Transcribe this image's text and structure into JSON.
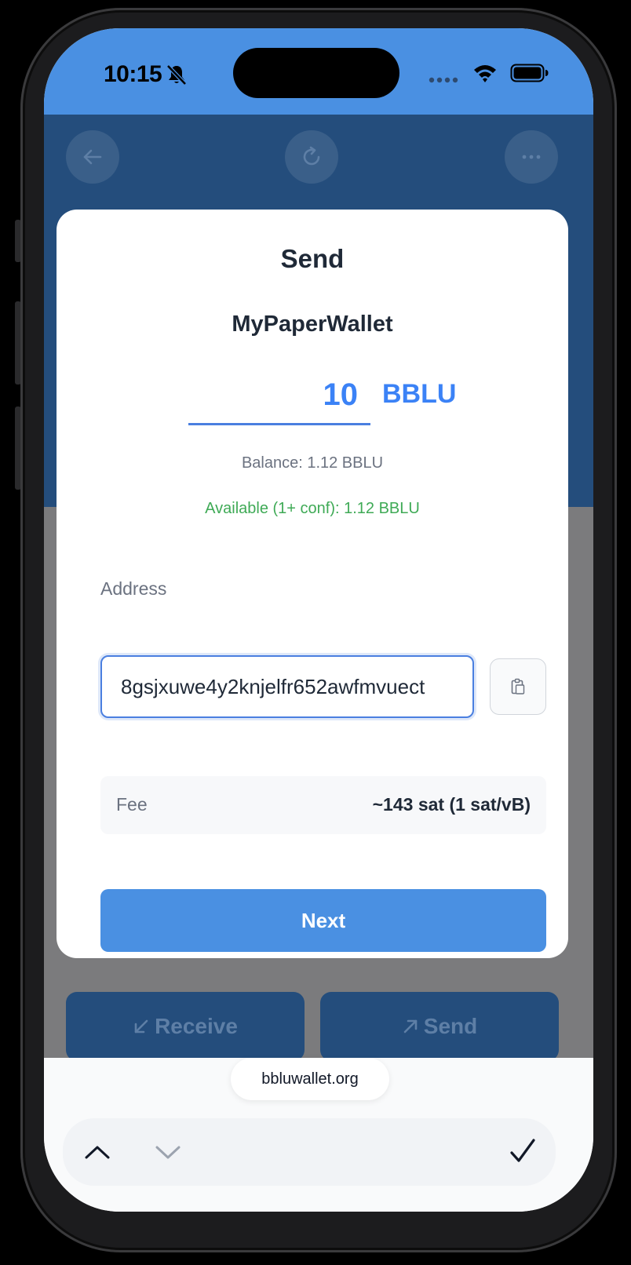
{
  "status_bar": {
    "time": "10:15"
  },
  "app": {
    "receive_label": "Receive",
    "send_label": "Send"
  },
  "modal": {
    "title": "Send",
    "wallet_name": "MyPaperWallet",
    "amount": "10",
    "unit": "BBLU",
    "balance": "Balance: 1.12 BBLU",
    "available": "Available (1+ conf): 1.12 BBLU",
    "address_label": "Address",
    "address_value": "8gsjxuwe4y2knjelfr652awfmvuect",
    "fee_label": "Fee",
    "fee_value": "~143 sat (1 sat/vB)",
    "next_label": "Next"
  },
  "browser": {
    "url": "bbluwallet.org"
  },
  "colors": {
    "accent": "#4a90e2",
    "header": "#244d7c",
    "available_green": "#3faa56",
    "amount_blue": "#3b82f6"
  },
  "icons": [
    "bell-slash-icon",
    "signal-icon",
    "wifi-icon",
    "battery-icon",
    "back-arrow-icon",
    "refresh-icon",
    "more-icon",
    "paste-icon",
    "arrow-down-left-icon",
    "arrow-up-right-icon",
    "chevron-up-icon",
    "chevron-down-icon",
    "checkmark-icon"
  ]
}
